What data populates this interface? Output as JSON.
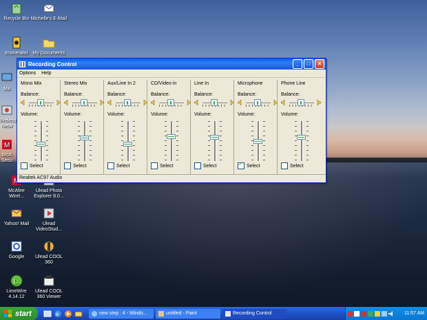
{
  "desktop": {
    "icons": [
      {
        "label_1": "Recycle Bin",
        "label_2": ""
      },
      {
        "label_1": "Michelle's E-Mail",
        "label_2": ""
      },
      {
        "label_1": "Imonerator",
        "label_2": ""
      },
      {
        "label_1": "My Documents",
        "label_2": ""
      },
      {
        "label_1": "Ma",
        "label_2": ""
      },
      {
        "label_1": "Wireless",
        "label_2": "Netw"
      },
      {
        "label_1": "McA",
        "label_2": "Secu"
      },
      {
        "label_1": "McAfee",
        "label_2": "Wirel..."
      },
      {
        "label_1": "Ulead Photo",
        "label_2": "Explorer 8.0..."
      },
      {
        "label_1": "Yahoo! Mail",
        "label_2": ""
      },
      {
        "label_1": "Ulead",
        "label_2": "VideoStud..."
      },
      {
        "label_1": "Google",
        "label_2": ""
      },
      {
        "label_1": "Ulead COOL",
        "label_2": "360"
      },
      {
        "label_1": "LimeWire",
        "label_2": "4.14.12"
      },
      {
        "label_1": "Ulead COOL",
        "label_2": "360 Viewer"
      }
    ]
  },
  "window": {
    "title": "Recording Control",
    "menu": [
      "Options",
      "Help"
    ],
    "balance_label": "Balance:",
    "volume_label": "Volume:",
    "select_label": "Select",
    "status": "Realtek AC97 Audio",
    "channels": [
      {
        "name": "Mono Mix",
        "volume": 0.42,
        "selected": false
      },
      {
        "name": "Stereo Mix",
        "volume": 0.58,
        "selected": false
      },
      {
        "name": "Aux/Line In 2",
        "volume": 0.42,
        "selected": false
      },
      {
        "name": "CD/Video in",
        "volume": 0.62,
        "selected": false
      },
      {
        "name": "Line In",
        "volume": 0.6,
        "selected": false
      },
      {
        "name": "Microphone",
        "volume": 0.5,
        "selected": true
      },
      {
        "name": "Phone Line",
        "volume": 0.6,
        "selected": false
      }
    ]
  },
  "taskbar": {
    "start_label": "start",
    "buttons": [
      {
        "label": "new step : 4 - Windo...",
        "active": false
      },
      {
        "label": "untitled - Paint",
        "active": false
      },
      {
        "label": "Recording Control",
        "active": true
      }
    ],
    "clock": "11:57 AM"
  },
  "colors": {
    "title_blue": "#0a5ee8",
    "taskbar_blue": "#245edb",
    "start_green": "#3aa63a",
    "window_face": "#ece9d8"
  }
}
